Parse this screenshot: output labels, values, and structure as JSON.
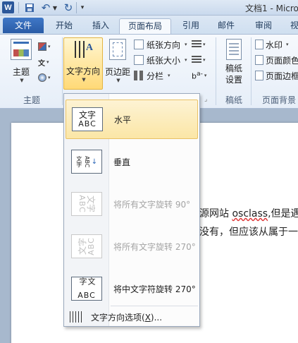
{
  "titlebar": {
    "app_logo": "W",
    "doc_title": "文档1 - Micro"
  },
  "tabs": [
    {
      "label": "文件"
    },
    {
      "label": "开始"
    },
    {
      "label": "插入"
    },
    {
      "label": "页面布局"
    },
    {
      "label": "引用"
    },
    {
      "label": "邮件"
    },
    {
      "label": "审阅"
    },
    {
      "label": "视"
    }
  ],
  "ribbon": {
    "theme_button": "主题",
    "theme_group": "主题",
    "text_direction": "文字方向",
    "margins": "页边距",
    "orientation": "纸张方向",
    "size": "纸张大小",
    "columns": "分栏",
    "paragraph_label_line1": "稿纸",
    "paragraph_label_line2": "设置",
    "draft_group": "稿纸",
    "watermark": "水印",
    "page_color": "页面颜色",
    "page_border": "页面边框",
    "bg_group": "页面背景",
    "hyphen_text": "b",
    "hyphen_suffix": "a-"
  },
  "document": {
    "line1_prefix": "源网站 ",
    "line1_word": "osclass",
    "line1_suffix": ",但是遇",
    "line2": "没有，但应该从属于一个"
  },
  "menu": {
    "items": [
      {
        "label": "水平",
        "icon_top": "文字",
        "icon_bottom": "ABC",
        "state": "selected"
      },
      {
        "label": "垂直",
        "icon_top": "文字",
        "icon_bottom": "ABC",
        "state": "normal"
      },
      {
        "label": "将所有文字旋转 90°",
        "icon_top": "文字",
        "icon_bottom": "ABC",
        "state": "disabled"
      },
      {
        "label": "将所有文字旋转 270°",
        "icon_top": "文字",
        "icon_bottom": "ABC",
        "state": "disabled"
      },
      {
        "label": "将中文字符旋转 270°",
        "icon_top": "文字",
        "icon_bottom": "ABC",
        "state": "normal"
      }
    ],
    "options_label": "文字方向选项(",
    "options_accel": "X",
    "options_suffix": ")..."
  }
}
